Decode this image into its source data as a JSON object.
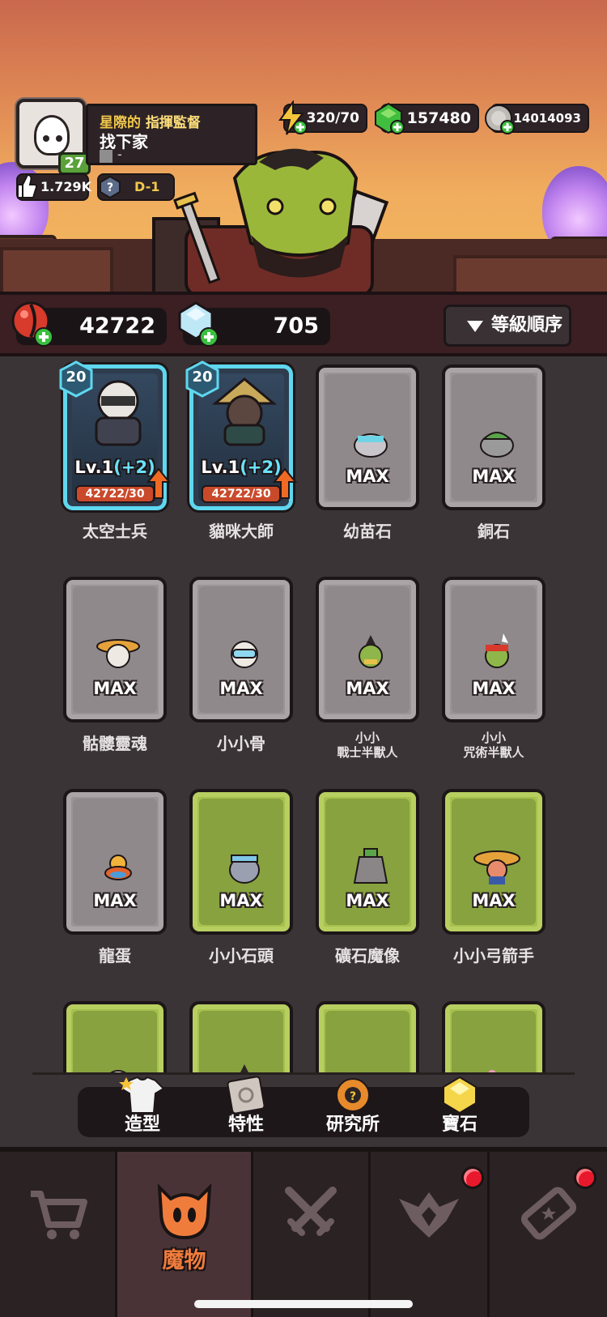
{
  "profile": {
    "title_prefix": "星際的",
    "title_suffix": "指揮監督",
    "name": "找下家",
    "guild": "-",
    "level": "27",
    "likes": "1.729K",
    "rank": "D-1"
  },
  "currencies": {
    "energy": "320/70",
    "gems": "157480",
    "coins": "14014093"
  },
  "resources": {
    "red_orb": "42722",
    "crystal": "705"
  },
  "sort_button": {
    "label": "等級順序"
  },
  "monsters": [
    {
      "name": "太空士兵",
      "type": "hero",
      "badge": "20",
      "level": "Lv.1",
      "bonus": "(+2)",
      "progress": "42722/30"
    },
    {
      "name": "貓咪大師",
      "type": "hero",
      "badge": "20",
      "level": "Lv.1",
      "bonus": "(+2)",
      "progress": "42722/30"
    },
    {
      "name": "幼苗石",
      "type": "grey",
      "status": "MAX"
    },
    {
      "name": "銅石",
      "type": "grey",
      "status": "MAX"
    },
    {
      "name": "骷髏靈魂",
      "type": "grey",
      "status": "MAX"
    },
    {
      "name": "小小骨",
      "type": "grey",
      "status": "MAX"
    },
    {
      "name_line1": "小小",
      "name_line2": "戰士半獸人",
      "type": "grey",
      "status": "MAX"
    },
    {
      "name_line1": "小小",
      "name_line2": "咒術半獸人",
      "type": "grey",
      "status": "MAX"
    },
    {
      "name": "龍蛋",
      "type": "grey",
      "status": "MAX"
    },
    {
      "name": "小小石頭",
      "type": "green",
      "status": "MAX"
    },
    {
      "name": "礦石魔像",
      "type": "green",
      "status": "MAX"
    },
    {
      "name": "小小弓箭手",
      "type": "green",
      "status": "MAX"
    }
  ],
  "subnav": [
    {
      "label": "造型",
      "icon": "shirt-icon"
    },
    {
      "label": "特性",
      "icon": "scroll-icon"
    },
    {
      "label": "研究所",
      "icon": "lab-icon"
    },
    {
      "label": "寶石",
      "icon": "gem-icon"
    }
  ],
  "tabs": [
    {
      "label": "",
      "icon": "cart-icon"
    },
    {
      "label": "魔物",
      "icon": "monster-icon"
    },
    {
      "label": "",
      "icon": "swords-icon"
    },
    {
      "label": "",
      "icon": "rank-wings-icon"
    },
    {
      "label": "",
      "icon": "ticket-icon"
    }
  ],
  "colors": {
    "accent_orange": "#f07c3c",
    "hero_border": "#5fd7ee",
    "green_card": "#a6c04d",
    "grey_card": "#9a9496",
    "notification": "#e8192c"
  }
}
